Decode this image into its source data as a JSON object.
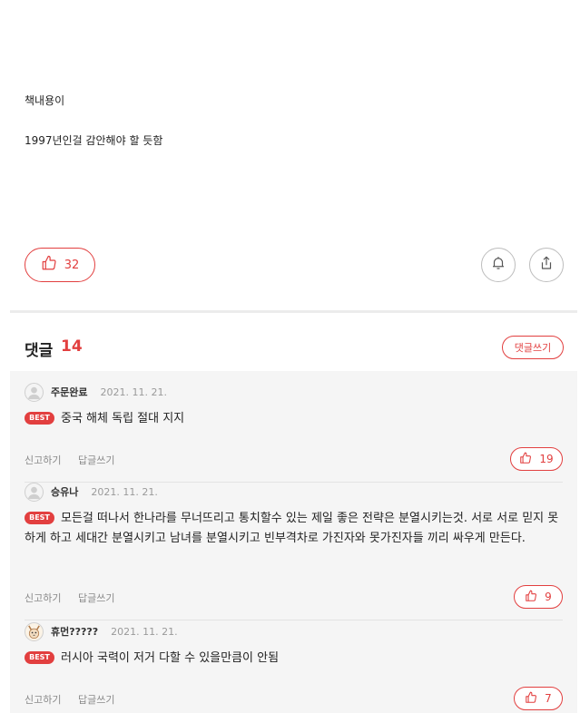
{
  "post": {
    "line1": "책내용이",
    "line2": "1997년인걸 감안해야 할 듯함"
  },
  "actions": {
    "like_count": "32",
    "like_icon": "thumbs-up-icon",
    "bell_icon": "bell-icon",
    "share_icon": "share-icon"
  },
  "comments": {
    "title": "댓글",
    "count": "14",
    "write_label": "댓글쓰기",
    "items": [
      {
        "name": "주문완료",
        "date": "2021. 11. 21.",
        "badge": "BEST",
        "text": "중국 해체 독립 절대 지지",
        "report": "신고하기",
        "reply": "답글쓰기",
        "likes": "19"
      },
      {
        "name": "승유나",
        "date": "2021. 11. 21.",
        "badge": "BEST",
        "text": "모든걸 떠나서 한나라를 무너뜨리고 통치할수 있는 제일 좋은 전략은 분열시키는것. 서로 서로 믿지 못하게 하고 세대간 분열시키고 남녀를 분열시키고 빈부격차로 가진자와 못가진자들 끼리 싸우게 만든다.",
        "report": "신고하기",
        "reply": "답글쓰기",
        "likes": "9"
      },
      {
        "name": "휴먼?????",
        "date": "2021. 11. 21.",
        "badge": "BEST",
        "text": "러시아 국력이 저거 다할 수 있을만큼이 안됨",
        "report": "신고하기",
        "reply": "답글쓰기",
        "likes": "7"
      }
    ]
  },
  "colors": {
    "accent": "#e23f3f",
    "muted": "#8a8a8a",
    "list_bg": "#f5f5f5"
  }
}
